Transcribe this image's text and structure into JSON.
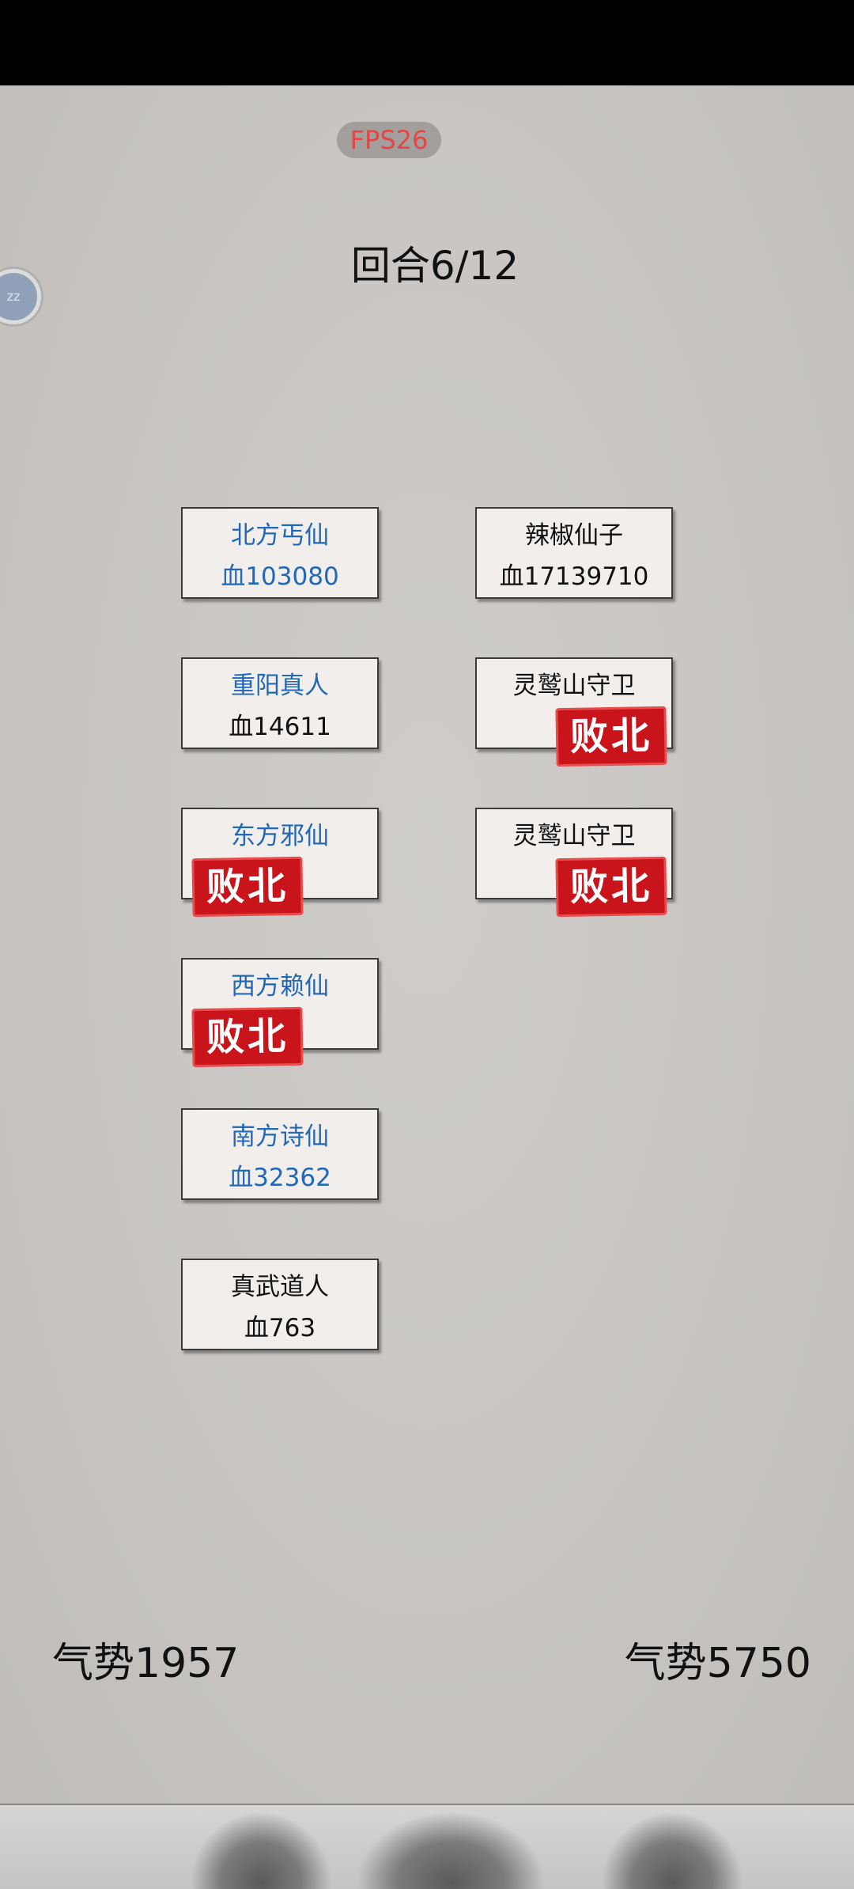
{
  "hud": {
    "fps": "FPS26",
    "round": "回合6/12",
    "float_ball": "zz"
  },
  "left_team": {
    "momentum": "气势1957",
    "units": [
      {
        "name": "北方丐仙",
        "hp": "血103080",
        "defeated": false
      },
      {
        "name": "重阳真人",
        "hp": "血14611",
        "defeated": false
      },
      {
        "name": "东方邪仙",
        "hp": "",
        "defeated": true
      },
      {
        "name": "西方赖仙",
        "hp": "",
        "defeated": true
      },
      {
        "name": "南方诗仙",
        "hp": "血32362",
        "defeated": false
      },
      {
        "name": "真武道人",
        "hp": "血763",
        "defeated": false
      }
    ]
  },
  "right_team": {
    "momentum": "气势5750",
    "units": [
      {
        "name": "辣椒仙子",
        "hp": "血17139710",
        "defeated": false
      },
      {
        "name": "灵鹫山守卫",
        "hp": "",
        "defeated": true
      },
      {
        "name": "灵鹫山守卫",
        "hp": "",
        "defeated": true
      }
    ]
  },
  "stamp_text": "败北",
  "colors": {
    "ally_text": "#2268b8",
    "enemy_text": "#111111",
    "stamp_red": "#c9141b"
  }
}
